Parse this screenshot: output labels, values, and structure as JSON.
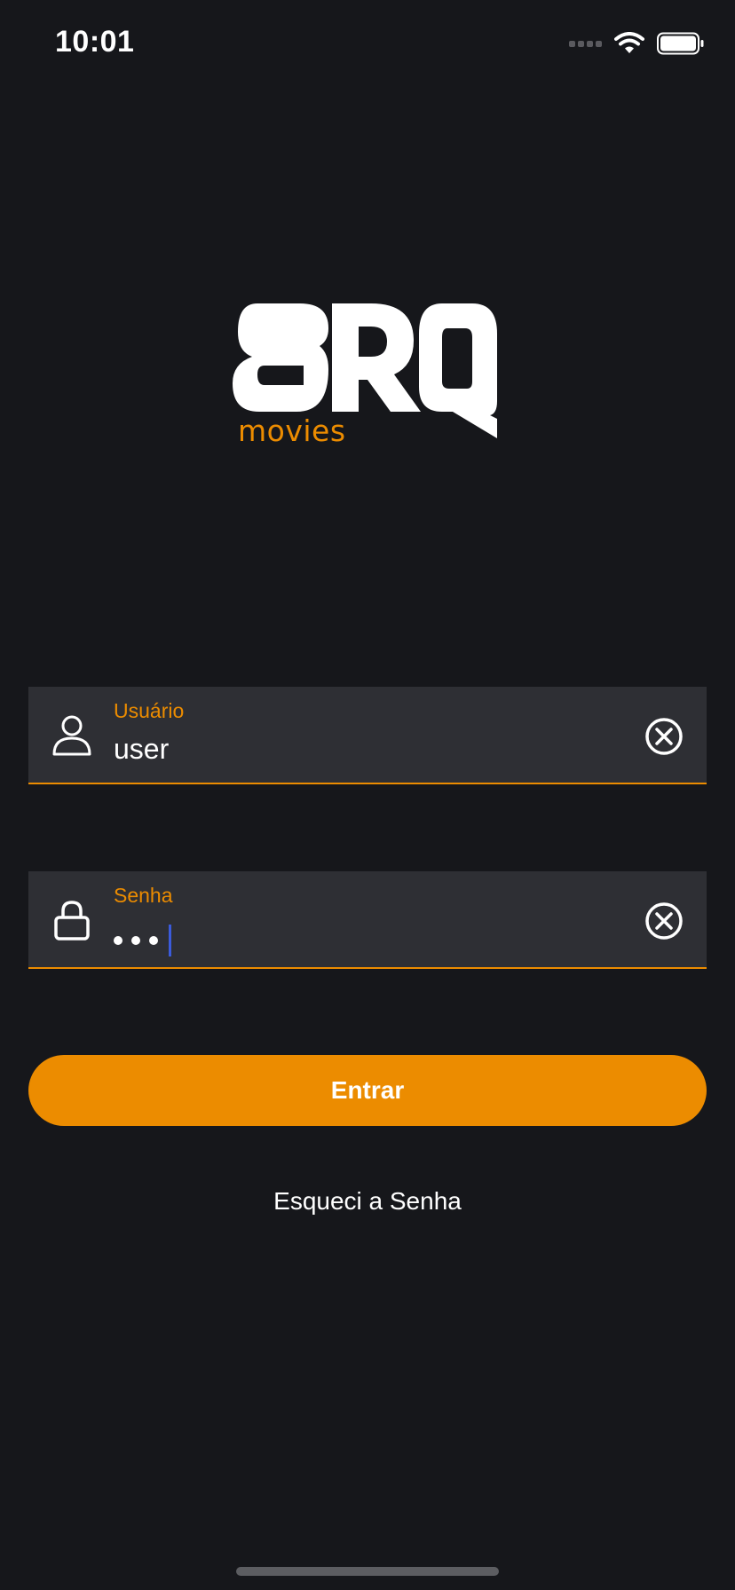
{
  "status_bar": {
    "time": "10:01",
    "icons": [
      "cellular-icon",
      "wifi-icon",
      "battery-icon"
    ]
  },
  "logo": {
    "wordmark": "BRQ",
    "sub": "movies"
  },
  "username_field": {
    "label": "Usuário",
    "value": "user",
    "icon": "user-icon",
    "clear_icon": "clear-circle-x-icon"
  },
  "password_field": {
    "label": "Senha",
    "masked_char_count": 3,
    "icon": "lock-icon",
    "clear_icon": "clear-circle-x-icon"
  },
  "login_button": {
    "label": "Entrar"
  },
  "forgot_link": {
    "label": "Esqueci a Senha"
  },
  "colors": {
    "background": "#16171b",
    "field_background": "#2e2f34",
    "accent": "#ec8c00",
    "text": "#ffffff",
    "caret": "#3b5bdb"
  }
}
